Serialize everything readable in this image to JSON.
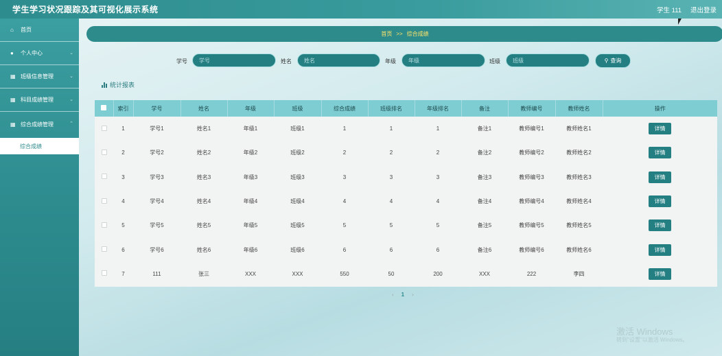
{
  "header": {
    "title": "学生学习状况跟踪及其可视化展示系统",
    "user": "学生 111",
    "logout": "退出登录"
  },
  "sidebar": {
    "items": [
      {
        "icon": "home-icon",
        "label": "首页"
      },
      {
        "icon": "user-icon",
        "label": "个人中心"
      },
      {
        "icon": "grid-icon",
        "label": "班级信息管理"
      },
      {
        "icon": "grid-icon",
        "label": "科目成绩管理"
      },
      {
        "icon": "grid-icon",
        "label": "综合成绩管理"
      }
    ],
    "active_sub": "综合成绩"
  },
  "breadcrumb": {
    "home": "首页",
    "sep": ">>",
    "current": "综合成绩"
  },
  "search": {
    "id_label": "学号",
    "id_placeholder": "学号",
    "name_label": "姓名",
    "name_placeholder": "姓名",
    "grade_label": "年级",
    "grade_placeholder": "年级",
    "class_label": "班级",
    "class_placeholder": "班级",
    "query": "查询"
  },
  "stats_link": "统计报表",
  "table": {
    "columns": [
      "索引",
      "学号",
      "姓名",
      "年级",
      "班级",
      "综合成绩",
      "班级排名",
      "年级排名",
      "备注",
      "教师编号",
      "教师姓名",
      "操作"
    ],
    "rows": [
      [
        "1",
        "学号1",
        "姓名1",
        "年级1",
        "班级1",
        "1",
        "1",
        "1",
        "备注1",
        "教师编号1",
        "教师姓名1"
      ],
      [
        "2",
        "学号2",
        "姓名2",
        "年级2",
        "班级2",
        "2",
        "2",
        "2",
        "备注2",
        "教师编号2",
        "教师姓名2"
      ],
      [
        "3",
        "学号3",
        "姓名3",
        "年级3",
        "班级3",
        "3",
        "3",
        "3",
        "备注3",
        "教师编号3",
        "教师姓名3"
      ],
      [
        "4",
        "学号4",
        "姓名4",
        "年级4",
        "班级4",
        "4",
        "4",
        "4",
        "备注4",
        "教师编号4",
        "教师姓名4"
      ],
      [
        "5",
        "学号5",
        "姓名5",
        "年级5",
        "班级5",
        "5",
        "5",
        "5",
        "备注5",
        "教师编号5",
        "教师姓名5"
      ],
      [
        "6",
        "学号6",
        "姓名6",
        "年级6",
        "班级6",
        "6",
        "6",
        "6",
        "备注6",
        "教师编号6",
        "教师姓名6"
      ],
      [
        "7",
        "111",
        "张三",
        "XXX",
        "XXX",
        "550",
        "50",
        "200",
        "XXX",
        "222",
        "李四"
      ]
    ],
    "detail": "详情"
  },
  "pager": {
    "prev": "‹",
    "page": "1",
    "next": "›"
  },
  "watermark": {
    "line1": "激活 Windows",
    "line2": "转到\"设置\"以激活 Windows。"
  },
  "colors": {
    "accent": "#247f82",
    "breadcrumb_text": "#ffe567",
    "table_header": "#7ecdd3"
  }
}
